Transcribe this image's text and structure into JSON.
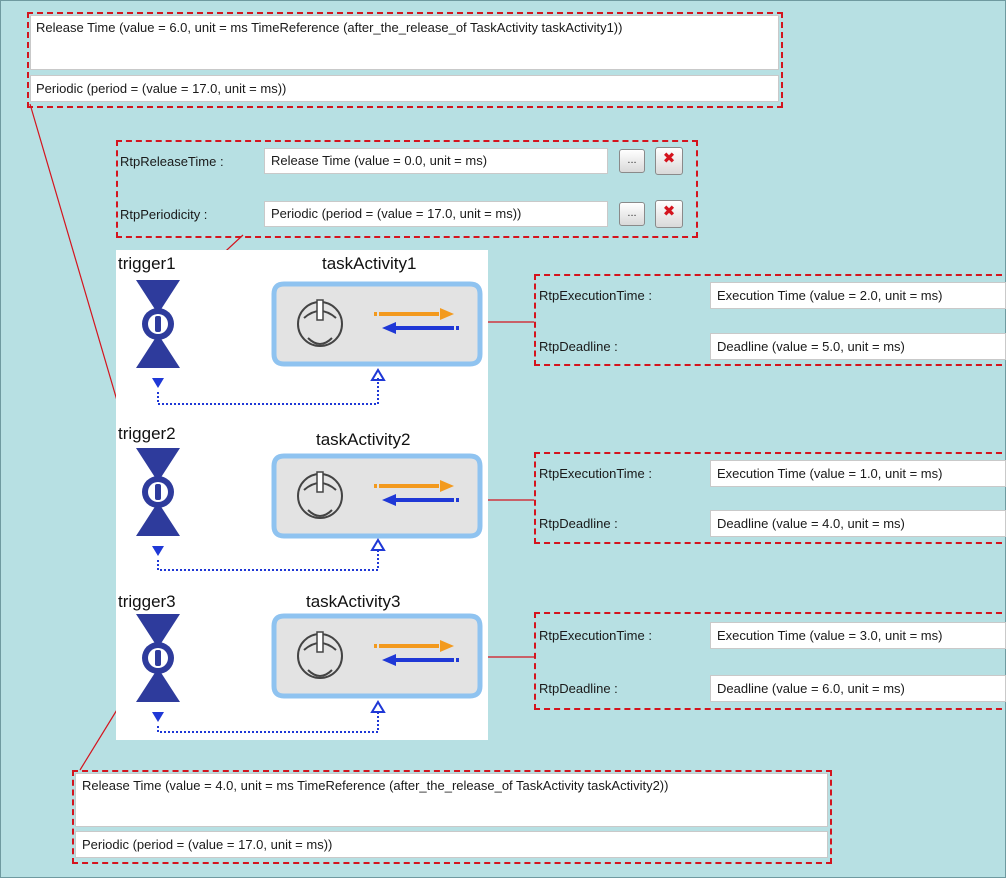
{
  "top_group": {
    "release_time": "Release Time (value = 6.0, unit = ms TimeReference (after_the_release_of TaskActivity taskActivity1))",
    "periodic": "Periodic (period = (value = 17.0, unit = ms))"
  },
  "trigger1_props": {
    "release_label": "RtpReleaseTime :",
    "release_value": "Release Time (value = 0.0, unit = ms)",
    "period_label": "RtpPeriodicity :",
    "period_value": "Periodic (period = (value = 17.0, unit = ms))",
    "browse_label": "...",
    "delete_glyph": "✖"
  },
  "diagram": {
    "triggers": [
      "trigger1",
      "trigger2",
      "trigger3"
    ],
    "tasks": [
      "taskActivity1",
      "taskActivity2",
      "taskActivity3"
    ]
  },
  "task_props": [
    {
      "exec_label": "RtpExecutionTime :",
      "exec_value": "Execution Time (value = 2.0, unit = ms)",
      "deadline_label": "RtpDeadline :",
      "deadline_value": "Deadline (value = 5.0, unit = ms)"
    },
    {
      "exec_label": "RtpExecutionTime :",
      "exec_value": "Execution Time (value = 1.0, unit = ms)",
      "deadline_label": "RtpDeadline :",
      "deadline_value": "Deadline (value = 4.0, unit = ms)"
    },
    {
      "exec_label": "RtpExecutionTime :",
      "exec_value": "Execution Time (value = 3.0, unit = ms)",
      "deadline_label": "RtpDeadline :",
      "deadline_value": "Deadline (value = 6.0, unit = ms)"
    }
  ],
  "bottom_group": {
    "release_time": "Release Time (value = 4.0, unit = ms TimeReference (after_the_release_of TaskActivity taskActivity2))",
    "periodic": "Periodic (period = (value = 17.0, unit = ms))"
  },
  "colors": {
    "background": "#b7e0e3",
    "dashed_border": "#d4141e",
    "trigger_fill": "#2e3b9c",
    "task_border": "#8fc3f0",
    "task_fill": "#e3e3e3",
    "arrow_orange": "#f39a1e",
    "arrow_blue": "#1f38d6",
    "link_dotted": "#1f38d6"
  }
}
